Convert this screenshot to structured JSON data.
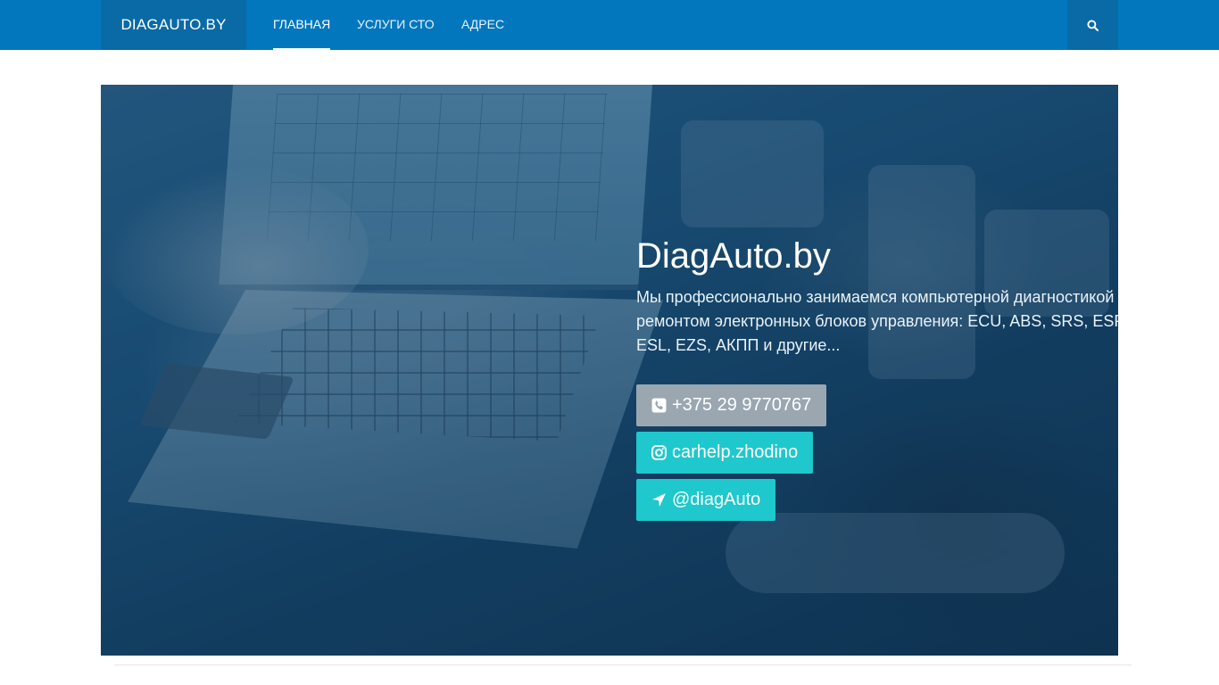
{
  "navbar": {
    "brand": "DIAGAUTO.BY",
    "items": [
      {
        "label": "ГЛАВНАЯ",
        "active": true
      },
      {
        "label": "УСЛУГИ СТО",
        "active": false
      },
      {
        "label": "АДРЕС",
        "active": false
      }
    ],
    "search_icon": "search-icon"
  },
  "hero": {
    "title": "DiagAuto.by",
    "text": "Мы профессионально занимаемся компьютерной диагностикой и ремонтом электронных блоков управления: ECU, ABS, SRS, ESP, ESL, EZS, АКПП и другие...",
    "buttons": [
      {
        "icon": "phone-icon",
        "label": "+375 29 9770767",
        "color": "#9aa7b1"
      },
      {
        "icon": "instagram-icon",
        "label": "carhelp.zhodino",
        "color": "#1ec8cc"
      },
      {
        "icon": "location-arrow-icon",
        "label": "@diagAuto",
        "color": "#1ec8cc"
      }
    ]
  },
  "colors": {
    "navbar": "#0277bd",
    "brand_bg": "#0a6aa6",
    "accent": "#1ec8cc"
  }
}
